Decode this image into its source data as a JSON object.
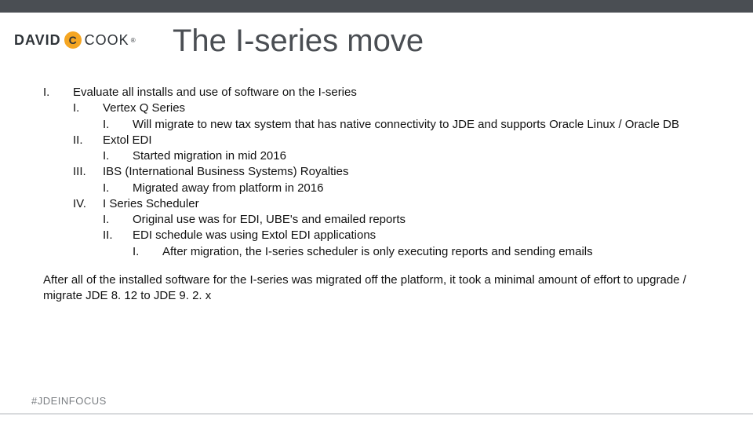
{
  "logo": {
    "left": "DAVID",
    "c": "C",
    "right": "COOK"
  },
  "title": "The I-series move",
  "outline": {
    "I": {
      "num": "I.",
      "text": "Evaluate all installs and use of software on the I-series",
      "I": {
        "num": "I.",
        "text": "Vertex Q Series",
        "I": {
          "num": "I.",
          "text": "Will migrate to new tax system that has native connectivity to JDE and supports Oracle Linux / Oracle DB"
        }
      },
      "II": {
        "num": "II.",
        "text": "Extol EDI",
        "I": {
          "num": "I.",
          "text": "Started migration in mid 2016"
        }
      },
      "III": {
        "num": "III.",
        "text": "IBS (International Business Systems) Royalties",
        "I": {
          "num": "I.",
          "text": "Migrated away from platform in 2016"
        }
      },
      "IV": {
        "num": "IV.",
        "text": "I Series Scheduler",
        "I": {
          "num": "I.",
          "text": "Original use was for EDI, UBE's and emailed reports"
        },
        "II": {
          "num": "II.",
          "text": "EDI schedule was using Extol EDI applications",
          "I": {
            "num": "I.",
            "text": "After migration, the I-series scheduler is only executing reports and sending emails"
          }
        }
      }
    }
  },
  "closing": "After all of the installed software for the I-series was migrated off the platform, it took a minimal amount of effort to upgrade / migrate JDE 8. 12 to JDE 9. 2. x",
  "hashtag": "#JDEINFOCUS"
}
